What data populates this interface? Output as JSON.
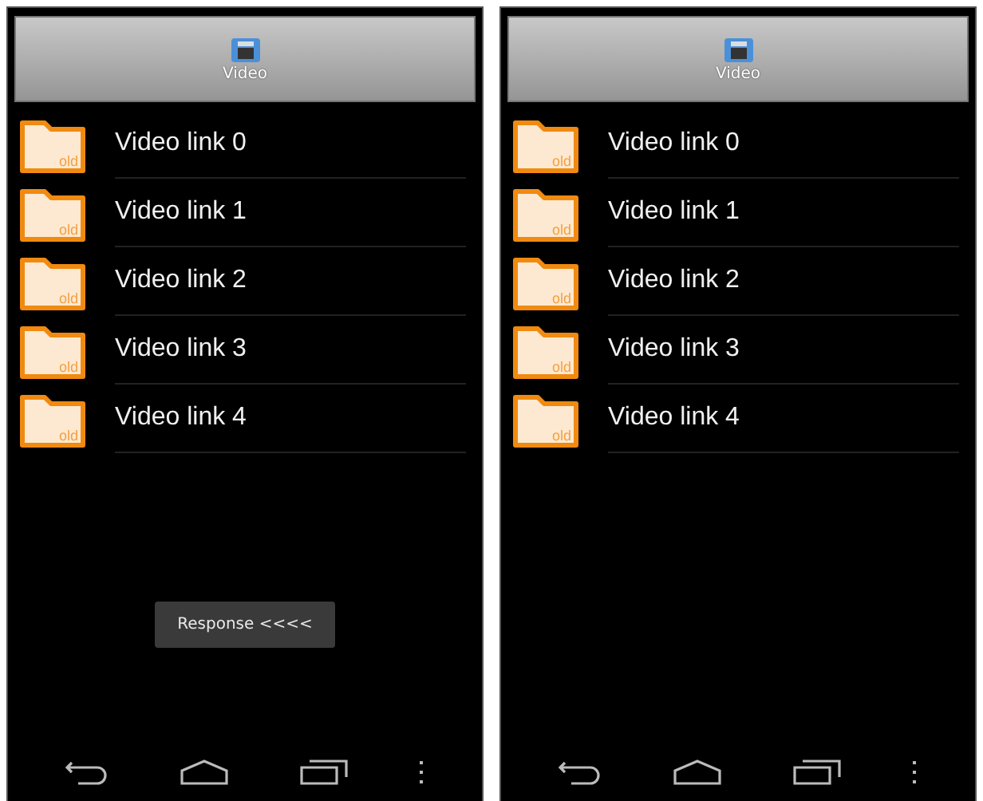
{
  "screens": [
    {
      "header": {
        "title": "Video"
      },
      "items": [
        {
          "label": "Video link 0",
          "icon_text": "old"
        },
        {
          "label": "Video link 1",
          "icon_text": "old"
        },
        {
          "label": "Video link 2",
          "icon_text": "old"
        },
        {
          "label": "Video link 3",
          "icon_text": "old"
        },
        {
          "label": "Video link 4",
          "icon_text": "old"
        }
      ],
      "toast": "Response <<<<"
    },
    {
      "header": {
        "title": "Video"
      },
      "items": [
        {
          "label": "Video link 0",
          "icon_text": "old"
        },
        {
          "label": "Video link 1",
          "icon_text": "old"
        },
        {
          "label": "Video link 2",
          "icon_text": "old"
        },
        {
          "label": "Video link 3",
          "icon_text": "old"
        },
        {
          "label": "Video link 4",
          "icon_text": "old"
        }
      ]
    }
  ]
}
